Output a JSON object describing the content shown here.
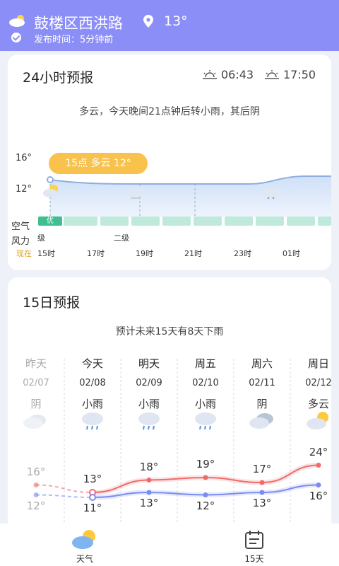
{
  "header": {
    "location": "鼓楼区西洪路",
    "temperature": "13°",
    "publish_text": "发布时间：5分钟前"
  },
  "hourly": {
    "title": "24小时预报",
    "sunrise": "06:43",
    "sunset": "17:50",
    "summary": "多云，今天晚间21点钟后转小雨，其后阴",
    "y_labels": [
      "16°",
      "12°"
    ],
    "air_label": "空气",
    "wind_label": "风力",
    "now_label": "现在",
    "tooltip": "15点 多云 12°",
    "air_quality_selected": "优",
    "wind_levels": [
      "级",
      "二级"
    ],
    "hours": [
      "15时",
      "17时",
      "19时",
      "21时",
      "23时",
      "01时"
    ]
  },
  "daily": {
    "title": "15日预报",
    "summary": "预计未来15天有8天下雨",
    "days": [
      {
        "name": "昨天",
        "date": "02/07",
        "condition": "阴",
        "icon": "cloudy-icon"
      },
      {
        "name": "今天",
        "date": "02/08",
        "condition": "小雨",
        "icon": "light-rain-icon"
      },
      {
        "name": "明天",
        "date": "02/09",
        "condition": "小雨",
        "icon": "light-rain-icon"
      },
      {
        "name": "周五",
        "date": "02/10",
        "condition": "小雨",
        "icon": "light-rain-icon"
      },
      {
        "name": "周六",
        "date": "02/11",
        "condition": "阴",
        "icon": "cloudy-icon"
      },
      {
        "name": "周日",
        "date": "02/12",
        "condition": "多云",
        "icon": "partly-cloudy-icon"
      }
    ],
    "chart_data": {
      "type": "line",
      "categories": [
        "02/07",
        "02/08",
        "02/09",
        "02/10",
        "02/11",
        "02/12"
      ],
      "series": [
        {
          "values": [
            16,
            13,
            18,
            19,
            17,
            24
          ],
          "color": "#ef6b6b"
        },
        {
          "values": [
            12,
            11,
            13,
            12,
            13,
            16
          ],
          "color": "#7b8cf0"
        }
      ],
      "high_labels": [
        "16°",
        "13°",
        "18°",
        "19°",
        "17°",
        "24°"
      ],
      "low_labels": [
        "12°",
        "11°",
        "13°",
        "12°",
        "13°",
        "16°"
      ]
    }
  },
  "tabs": [
    {
      "label": "天气",
      "icon": "weather-icon",
      "active": true
    },
    {
      "label": "15天",
      "icon": "calendar-icon",
      "active": false
    }
  ],
  "colors": {
    "header_bg": "#8b8ef7",
    "accent_orange": "#f8c24c",
    "air_good": "#3fbf8f",
    "high_line": "#ef6b6b",
    "low_line": "#7b8cf0"
  }
}
